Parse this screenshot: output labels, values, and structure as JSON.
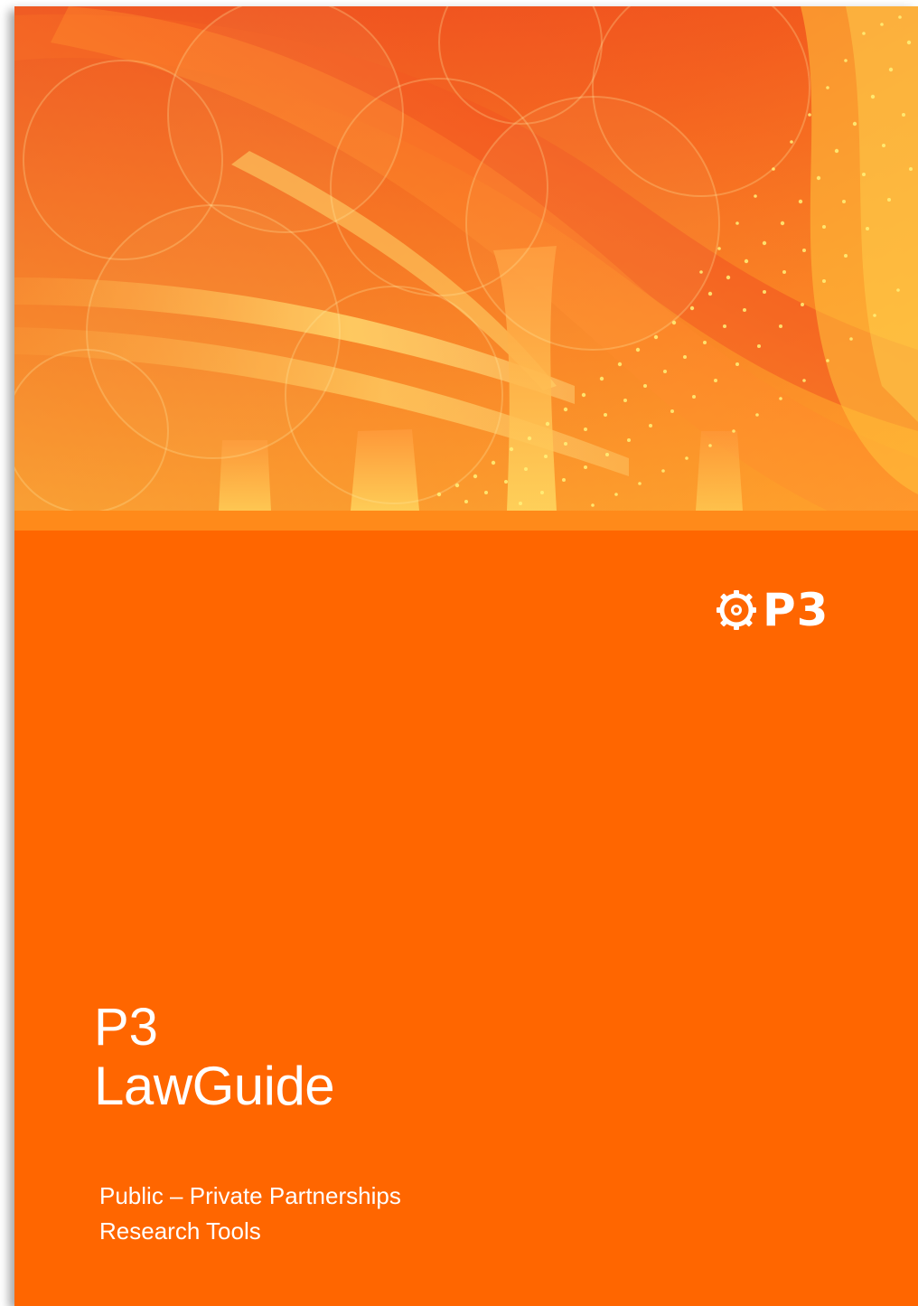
{
  "cover": {
    "colors": {
      "background": "#ff6600",
      "accent_strip": "#ff8a1a",
      "hero_red": "#e8321e",
      "hero_yellow": "#ffd23c",
      "text": "#ffffff"
    },
    "hero_image": "highway-overpass-photo",
    "logo": {
      "icon": "gear-icon",
      "text": "P3"
    },
    "title": {
      "line1": "P3",
      "line2": "LawGuide"
    },
    "subtitle": {
      "line1": "Public – Private Partnerships",
      "line2": "Research Tools"
    }
  }
}
